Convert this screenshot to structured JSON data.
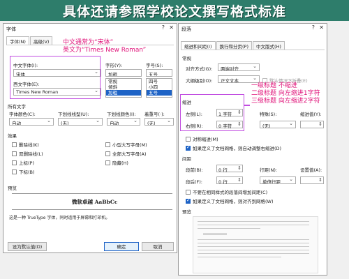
{
  "banner": {
    "title": "具体还请参照学校论文撰写格式标准"
  },
  "font_dialog": {
    "title": "字体",
    "tabs": [
      "字体(N)",
      "高级(V)"
    ],
    "chinese_font_label": "中文字体(I):",
    "chinese_font_value": "宋体",
    "western_font_label": "西文字体(E):",
    "western_font_value": "Times New Roman",
    "style_label": "字形(Y):",
    "style_value": "加粗",
    "style_options": [
      "常规",
      "倾斜",
      "加粗"
    ],
    "size_label": "字号(S):",
    "size_value": "五号",
    "size_options": [
      "四号",
      "小四",
      "五号"
    ],
    "all_text_label": "所有文字",
    "font_color_label": "字体颜色(C):",
    "font_color_value": "自动",
    "underline_label": "下划线线型(U):",
    "underline_value": "(无)",
    "underline_color_label": "下划线颜色(I):",
    "underline_color_value": "自动",
    "emphasis_label": "着重号(·):",
    "emphasis_value": "(无)",
    "effects_label": "效果",
    "effects": [
      {
        "label": "删除线(K)",
        "checked": false
      },
      {
        "label": "双删除线(L)",
        "checked": false
      },
      {
        "label": "上标(P)",
        "checked": false
      },
      {
        "label": "下标(B)",
        "checked": false
      },
      {
        "label": "小型大写字母(M)",
        "checked": false
      },
      {
        "label": "全部大写字母(A)",
        "checked": false
      },
      {
        "label": "隐藏(H)",
        "checked": false
      }
    ],
    "preview_label": "预览",
    "preview_text": "微软卓越 AaBbCc",
    "preview_note": "这是一种 TrueType 字体，同时适用于屏幕和打印机。",
    "set_default_button": "设为默认值(D)",
    "ok_button": "确定",
    "cancel_button": "取消"
  },
  "para_dialog": {
    "title": "段落",
    "tabs": [
      "缩进和间距(I)",
      "换行和分页(P)",
      "中文版式(H)"
    ],
    "general_label": "常规",
    "align_label": "对齐方式(G):",
    "align_value": "两端对齐",
    "outline_label": "大纲级别(O):",
    "outline_value": "正文文本",
    "collapse_label": "默认情况下折叠(E)",
    "indent_label": "缩进",
    "left_label": "左侧(L):",
    "left_value": "1 字符",
    "right_label": "右侧(R):",
    "right_value": "0 字符",
    "special_label": "特殊(S):",
    "special_value": "(无)",
    "indent_value_label": "缩进值(Y):",
    "mirror_label": "对称缩进(M)",
    "grid_indent_label": "如果定义了文档网格，则自动调整右缩进(D)",
    "spacing_label": "间距",
    "before_label": "段前(B):",
    "before_value": "0 行",
    "after_label": "段后(F):",
    "after_value": "0 行",
    "line_label": "行距(N):",
    "line_value": "单倍行距",
    "setting_label": "设置值(A):",
    "no_space_label": "不要在相同样式的段落间增加间距(C)",
    "snap_grid_label": "如果定义了文档网格，则对齐到网格(W)",
    "preview_label": "预览"
  },
  "annotations": {
    "font_note_1": "中文通常为“宋体”",
    "font_note_2": "英文为“Times New Roman”",
    "indent_note_1": "一级标题 不缩进",
    "indent_note_2": "二级标题 向左缩进1字符",
    "indent_note_3": "三级标题 向左缩进2字符"
  },
  "colors": {
    "banner": "#2e7d6b",
    "accent": "#c14de0",
    "annotation": "#e0157a",
    "selected": "#1e63c6"
  }
}
